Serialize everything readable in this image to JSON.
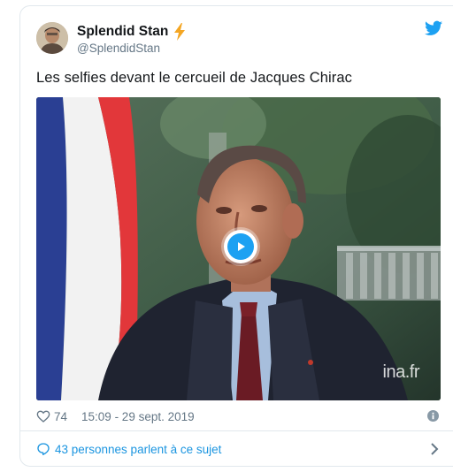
{
  "user": {
    "name": "Splendid Stan",
    "handle": "@SplendidStan"
  },
  "tweet": {
    "text": "Les selfies devant le cercueil de Jacques Chirac"
  },
  "media": {
    "watermark": "ina.fr",
    "play_icon": "play-icon"
  },
  "meta": {
    "likes": "74",
    "timestamp": "15:09 - 29 sept. 2019"
  },
  "conversation": {
    "label": "43 personnes parlent à ce sujet"
  },
  "colors": {
    "accent": "#1da1f2",
    "link": "#1b95e0",
    "secondary_text": "#657786",
    "border": "#e1e8ed"
  }
}
